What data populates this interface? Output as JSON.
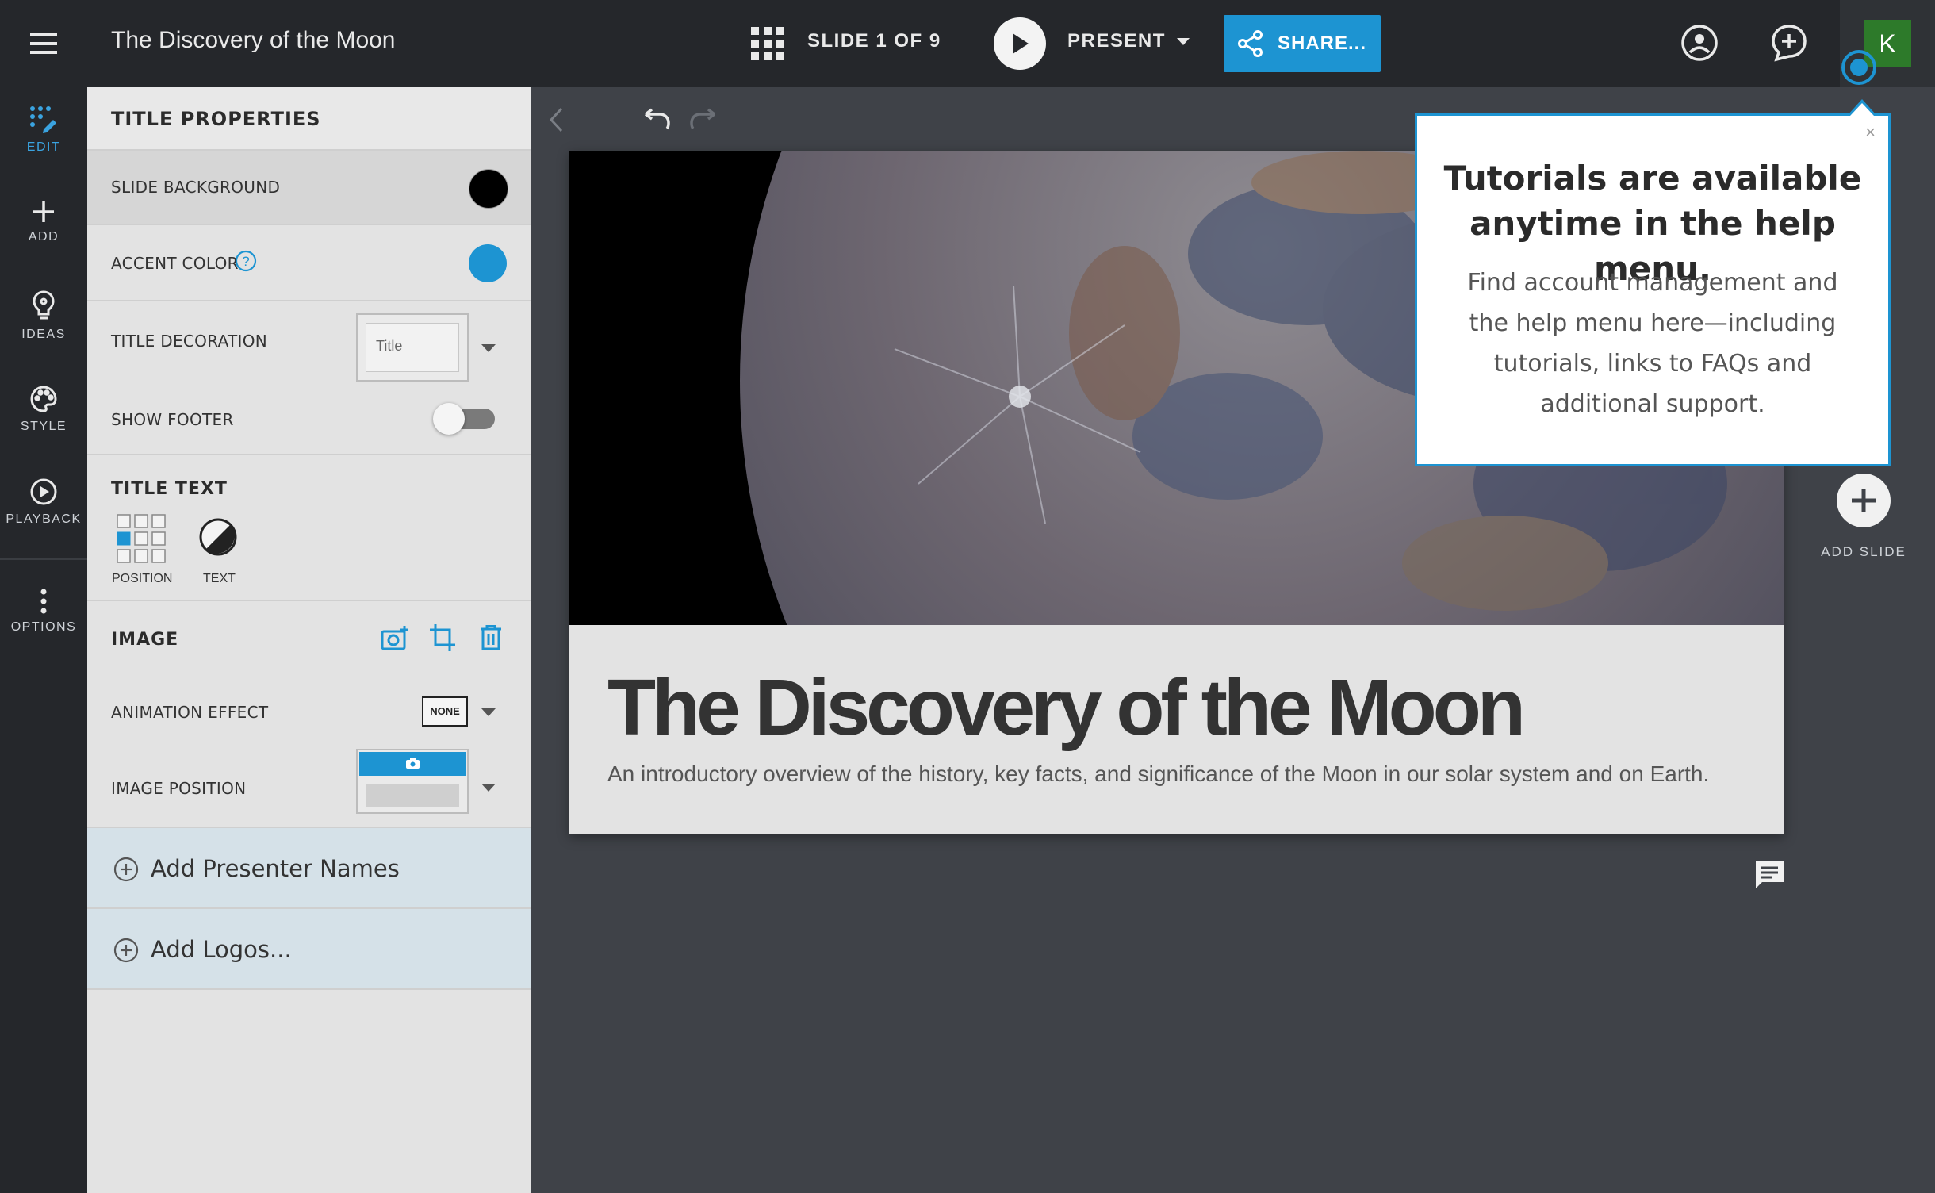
{
  "app": {
    "doc_title": "The Discovery of the Moon",
    "slide_counter": "SLIDE 1 OF 9",
    "present_label": "PRESENT",
    "share_label": "SHARE...",
    "avatar_initial": "K"
  },
  "rail": {
    "items": [
      {
        "label": "EDIT",
        "icon": "edit-icon"
      },
      {
        "label": "ADD",
        "icon": "plus-icon"
      },
      {
        "label": "IDEAS",
        "icon": "lightbulb-icon"
      },
      {
        "label": "STYLE",
        "icon": "palette-icon"
      },
      {
        "label": "PLAYBACK",
        "icon": "play-circle-icon"
      },
      {
        "label": "OPTIONS",
        "icon": "more-vertical-icon"
      }
    ]
  },
  "panel": {
    "header": "TITLE PROPERTIES",
    "slide_background_label": "SLIDE BACKGROUND",
    "slide_background_color": "#000000",
    "accent_color_label": "ACCENT COLOR",
    "accent_color": "#1d94d2",
    "title_decoration_label": "TITLE DECORATION",
    "title_decoration_value": "Title",
    "show_footer_label": "SHOW FOOTER",
    "show_footer_on": false,
    "title_text_header": "TITLE TEXT",
    "position_label": "POSITION",
    "text_label": "TEXT",
    "image_header": "IMAGE",
    "animation_effect_label": "ANIMATION EFFECT",
    "animation_effect_value": "NONE",
    "image_position_label": "IMAGE POSITION",
    "add_presenter_names": "Add Presenter Names",
    "add_logos": "Add Logos..."
  },
  "slide": {
    "title": "The Discovery of the Moon",
    "subtitle": "An introductory overview of the history, key facts, and significance of the Moon in our solar system and on Earth."
  },
  "tooltip": {
    "title": "Tutorials are available anytime in the help menu.",
    "body": "Find account management and the help menu here—including tutorials, links to FAQs and additional support.",
    "close": "×"
  },
  "add_slide_label": "ADD SLIDE"
}
